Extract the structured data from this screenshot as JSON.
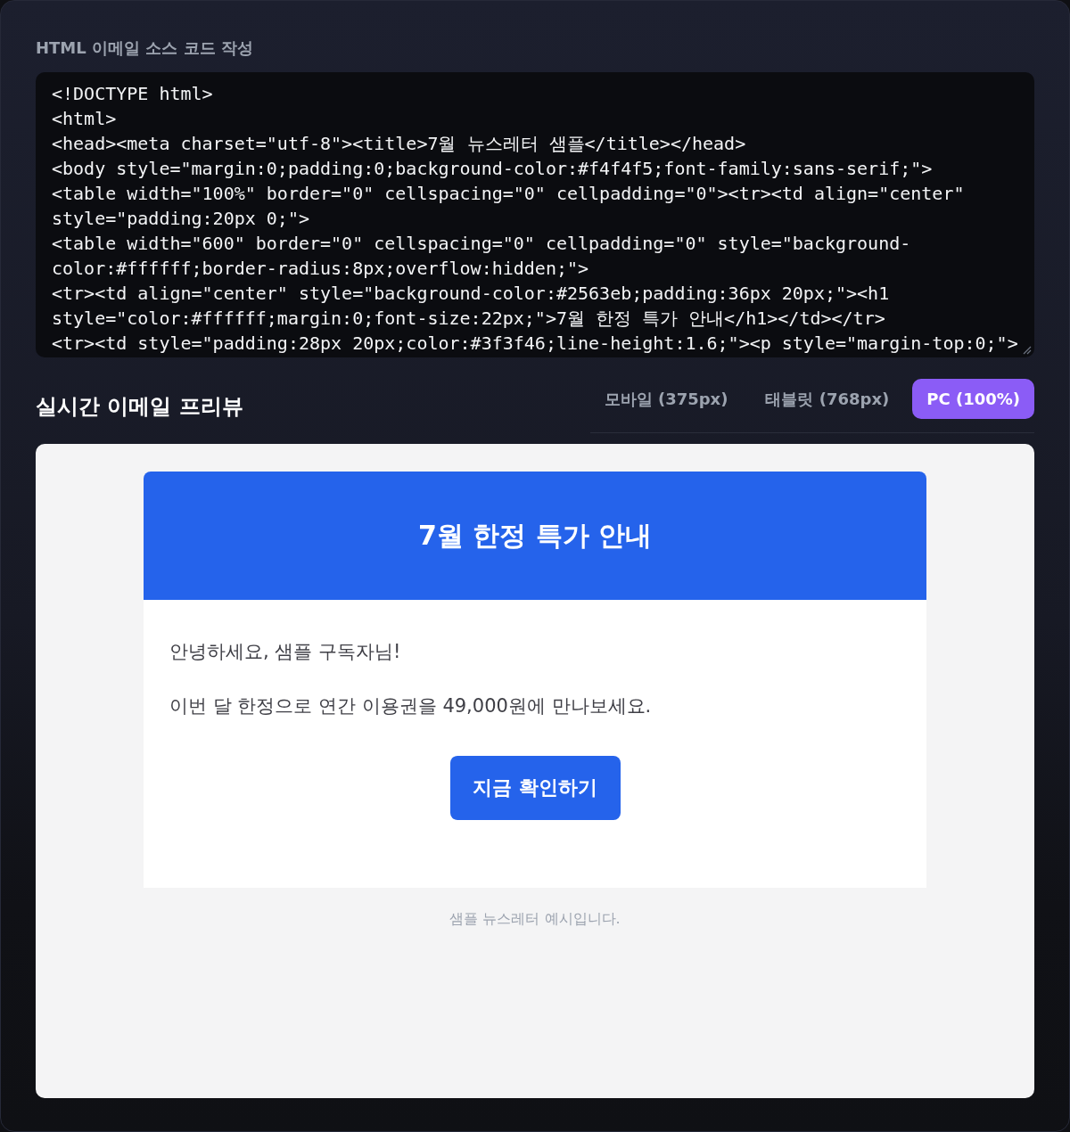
{
  "editor": {
    "label": "HTML 이메일 소스 코드 작성",
    "code_lines": [
      "<!DOCTYPE html>",
      "<html>",
      "<head><meta charset=\"utf-8\"><title>7월 뉴스레터 샘플</title></head>",
      "<body style=\"margin:0;padding:0;background-color:#f4f4f5;font-family:sans-serif;\">",
      "<table width=\"100%\" border=\"0\" cellspacing=\"0\" cellpadding=\"0\"><tr><td align=\"center\"",
      "style=\"padding:20px 0;\">",
      "<table width=\"600\" border=\"0\" cellspacing=\"0\" cellpadding=\"0\" style=\"background-",
      "color:#ffffff;border-radius:8px;overflow:hidden;\">",
      "<tr><td align=\"center\" style=\"background-color:#2563eb;padding:36px 20px;\"><h1",
      "style=\"color:#ffffff;margin:0;font-size:22px;\">7월 한정 특가 안내</h1></td></tr>",
      "<tr><td style=\"padding:28px 20px;color:#3f3f46;line-height:1.6;\"><p style=\"margin-top:0;\">"
    ]
  },
  "preview": {
    "title": "실시간 이메일 프리뷰",
    "tabs": [
      {
        "label": "모바일 (375px)",
        "selected": false
      },
      {
        "label": "태블릿 (768px)",
        "selected": false
      },
      {
        "label": "PC (100%)",
        "selected": true
      }
    ],
    "email": {
      "header_title": "7월 한정 특가 안내",
      "paragraphs": [
        "안녕하세요, 샘플 구독자님!",
        "이번 달 한정으로 연간 이용권을 49,000원에 만나보세요."
      ],
      "button": "지금 확인하기",
      "footer": "샘플 뉴스레터 예시입니다."
    }
  }
}
